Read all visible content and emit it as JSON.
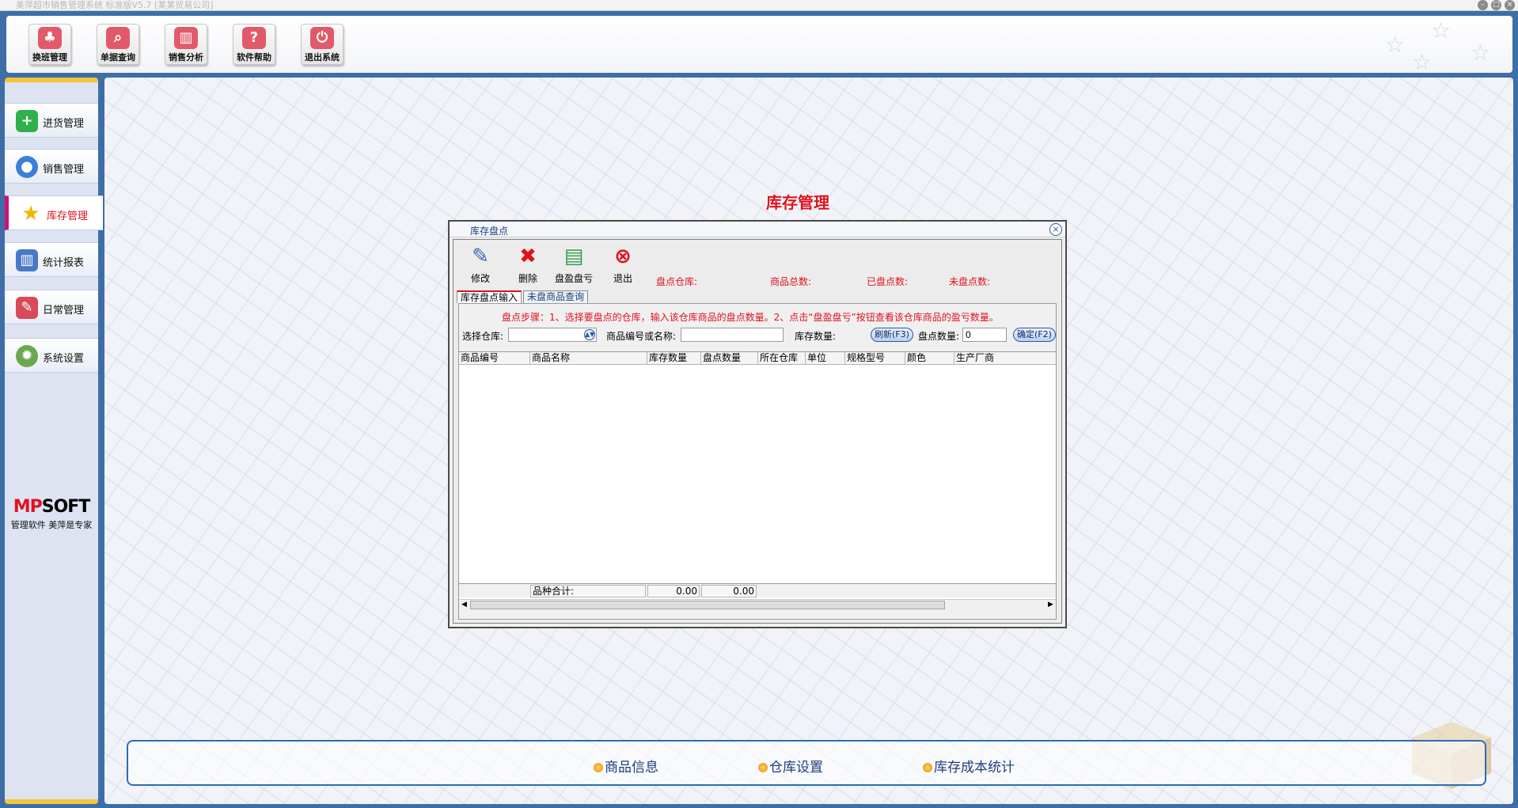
{
  "window": {
    "title": "美萍超市销售管理系统 标准版V5.7 [某某贸易公司]",
    "buttons": [
      "–",
      "□",
      "×"
    ]
  },
  "toolbar": {
    "items": [
      {
        "label": "换班管理",
        "icon": "shift-icon",
        "color": "#d84a5a"
      },
      {
        "label": "单据查询",
        "icon": "search-doc-icon",
        "color": "#d84a5a"
      },
      {
        "label": "销售分析",
        "icon": "bar-chart-icon",
        "color": "#d84a5a"
      },
      {
        "label": "软件帮助",
        "icon": "help-icon",
        "color": "#d84a5a"
      },
      {
        "label": "退出系统",
        "icon": "power-icon",
        "color": "#d84a5a"
      }
    ]
  },
  "sidebar": {
    "items": [
      {
        "label": "进货管理",
        "icon": "plus-icon",
        "color": "#2fb04a"
      },
      {
        "label": "销售管理",
        "icon": "globe-icon",
        "color": "#3b7fd8"
      },
      {
        "label": "库存管理",
        "icon": "star-icon",
        "color": "#f2b500"
      },
      {
        "label": "统计报表",
        "icon": "bar-chart-icon",
        "color": "#4a78c8"
      },
      {
        "label": "日常管理",
        "icon": "tools-icon",
        "color": "#d84a5a"
      },
      {
        "label": "系统设置",
        "icon": "gear-icon",
        "color": "#6aa84f"
      }
    ],
    "active_index": 2,
    "brand_logo_left": "MP",
    "brand_logo_right": "SOFT",
    "brand_slogan": "管理软件 美萍是专家"
  },
  "page_title": "库存管理",
  "dialog": {
    "title": "库存盘点",
    "close": "×",
    "tools": [
      {
        "label": "修改",
        "icon": "edit-icon",
        "glyph": "✎",
        "color": "#3a66b0"
      },
      {
        "label": "删除",
        "icon": "delete-icon",
        "glyph": "✖",
        "color": "#e0101e"
      },
      {
        "label": "盘盈盘亏",
        "icon": "book-icon",
        "glyph": "▤",
        "color": "#2fa04a"
      },
      {
        "label": "退出",
        "icon": "exit-icon",
        "glyph": "⊗",
        "color": "#e0101e"
      }
    ],
    "stats": {
      "warehouse_label": "盘点仓库:",
      "total_label": "商品总数:",
      "counted_label": "已盘点数:",
      "uncounted_label": "未盘点数:"
    },
    "tabs": [
      {
        "label": "库存盘点输入",
        "active": true
      },
      {
        "label": "未盘商品查询",
        "active": false
      }
    ],
    "steps_text": "盘点步骤：1、选择要盘点的仓库，输入该仓库商品的盘点数量。2、点击“盘盈盘亏”按钮查看该仓库商品的盈亏数量。",
    "form": {
      "warehouse_label": "选择仓库:",
      "warehouse_value": "",
      "product_label": "商品编号或名称:",
      "product_value": "",
      "stock_label": "库存数量:",
      "refresh_button": "刷新(F3)",
      "count_label": "盘点数量:",
      "count_value": "0",
      "confirm_button": "确定(F2)"
    },
    "grid": {
      "columns": [
        "商品编号",
        "商品名称",
        "库存数量",
        "盘点数量",
        "所在仓库",
        "单位",
        "规格型号",
        "颜色",
        "生产厂商"
      ],
      "rows": [],
      "footer_label": "品种合计:",
      "footer_stock": "0.00",
      "footer_count": "0.00"
    }
  },
  "quicklinks": [
    {
      "label": "商品信息"
    },
    {
      "label": "仓库设置"
    },
    {
      "label": "库存成本统计"
    }
  ]
}
